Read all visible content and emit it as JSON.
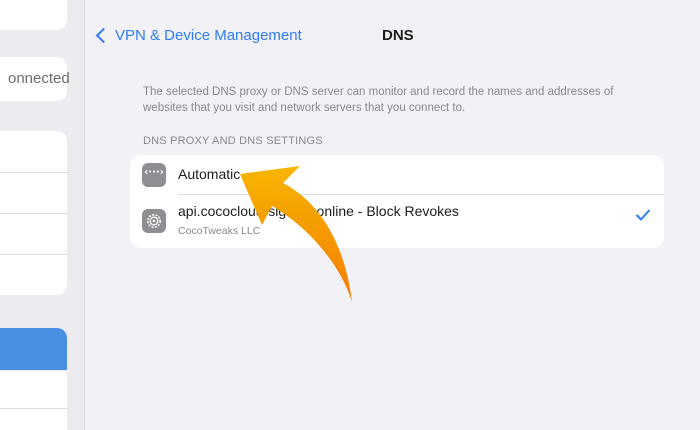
{
  "sidebar": {
    "partial_status": "onnected"
  },
  "nav": {
    "back_label": "VPN & Device Management",
    "title": "DNS"
  },
  "description": "The selected DNS proxy or DNS server can monitor and record the names and addresses of websites that you visit and network servers that you connect to.",
  "section_header": "DNS PROXY AND DNS SETTINGS",
  "options": [
    {
      "label": "Automatic",
      "icon": "dots-icon",
      "selected": false
    },
    {
      "label": "api.cococloud-signing.online - Block Revokes",
      "subtitle": "CocoTweaks LLC",
      "icon": "gear-icon",
      "selected": true
    }
  ],
  "colors": {
    "accent": "#2f7cf6",
    "arrow_start": "#f7b500",
    "arrow_end": "#f57c00",
    "sidebar_selected": "#4a90e2"
  }
}
